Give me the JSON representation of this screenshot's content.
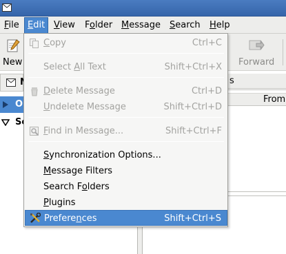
{
  "menubar": {
    "items": [
      {
        "label": "File",
        "mnemonic": "F",
        "rest": "ile"
      },
      {
        "label": "Edit",
        "mnemonic": "E",
        "rest": "dit"
      },
      {
        "label": "View",
        "mnemonic": "V",
        "rest": "iew"
      },
      {
        "label": "Folder",
        "mnemonic": "o",
        "pre": "F",
        "rest": "lder"
      },
      {
        "label": "Message",
        "mnemonic": "M",
        "rest": "essage"
      },
      {
        "label": "Search",
        "mnemonic": "S",
        "rest": "earch"
      },
      {
        "label": "Help",
        "mnemonic": "H",
        "rest": "elp"
      }
    ]
  },
  "toolbar": {
    "new_label": "New",
    "forward_label": "Forward"
  },
  "headers": {
    "folder_pane_partial": "N",
    "right_tab_partial": "s",
    "from_column": "From"
  },
  "tree": {
    "row1_partial": "O",
    "row2_partial": "Se"
  },
  "edit_menu": {
    "copy": {
      "pre": "",
      "mn": "C",
      "post": "opy",
      "accel": "Ctrl+C"
    },
    "select_all": {
      "pre": "Select ",
      "mn": "A",
      "post": "ll Text",
      "accel": "Shift+Ctrl+X"
    },
    "delete_message": {
      "pre": "",
      "mn": "D",
      "post": "elete Message",
      "accel": "Ctrl+D"
    },
    "undelete_message": {
      "pre": "",
      "mn": "U",
      "post": "ndelete Message",
      "accel": "Shift+Ctrl+D"
    },
    "find_in_message": {
      "pre": "",
      "mn": "F",
      "post": "ind in Message...",
      "accel": "Shift+Ctrl+F"
    },
    "sync_options": {
      "pre": "",
      "mn": "S",
      "post": "ynchronization Options...",
      "accel": ""
    },
    "message_filters": {
      "pre": "",
      "mn": "M",
      "post": "essage Filters",
      "accel": ""
    },
    "search_folders": {
      "pre": "Search F",
      "mn": "o",
      "post": "lders",
      "accel": ""
    },
    "plugins": {
      "pre": "",
      "mn": "P",
      "post": "lugins",
      "accel": ""
    },
    "preferences": {
      "pre": "Prefere",
      "mn": "n",
      "post": "ces",
      "accel": "Shift+Ctrl+S"
    }
  }
}
